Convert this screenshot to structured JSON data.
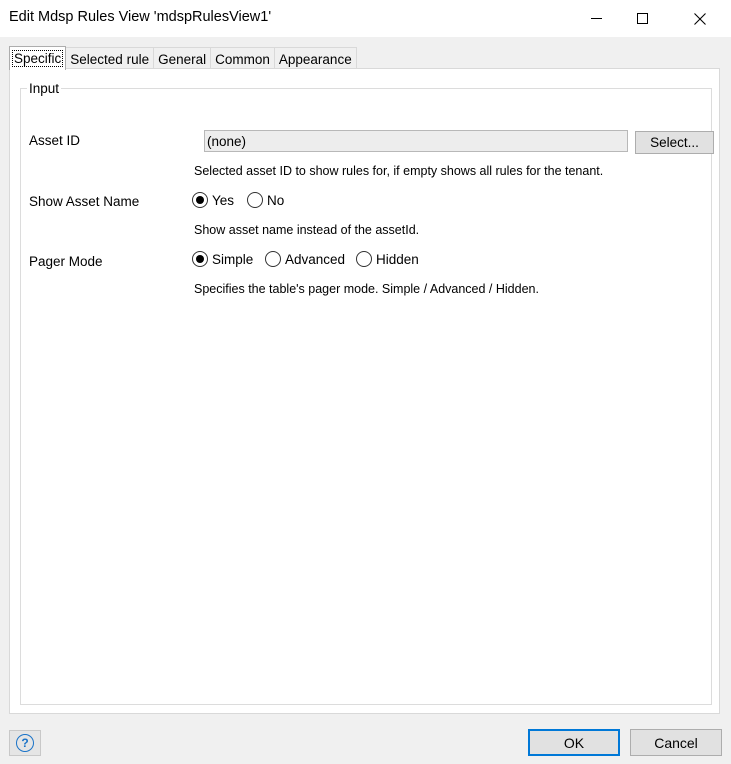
{
  "window": {
    "title": "Edit Mdsp Rules View 'mdspRulesView1'",
    "icons": {
      "minimize": "minimize-icon",
      "maximize": "maximize-icon",
      "close": "close-icon"
    }
  },
  "tabs": [
    {
      "label": "Specific",
      "active": true
    },
    {
      "label": "Selected rule"
    },
    {
      "label": "General"
    },
    {
      "label": "Common"
    },
    {
      "label": "Appearance"
    }
  ],
  "group": {
    "legend": "Input",
    "asset_id": {
      "label": "Asset ID",
      "value": "(none)",
      "select_label": "Select...",
      "description": "Selected asset ID to show rules for, if empty shows all rules for the tenant."
    },
    "show_asset_name": {
      "label": "Show Asset Name",
      "options": [
        "Yes",
        "No"
      ],
      "selected": "Yes",
      "description": "Show asset name instead of the assetId."
    },
    "pager_mode": {
      "label": "Pager Mode",
      "options": [
        "Simple",
        "Advanced",
        "Hidden"
      ],
      "selected": "Simple",
      "description": "Specifies the table's pager mode.  Simple / Advanced / Hidden."
    }
  },
  "footer": {
    "help_glyph": "?",
    "ok_label": "OK",
    "cancel_label": "Cancel"
  }
}
